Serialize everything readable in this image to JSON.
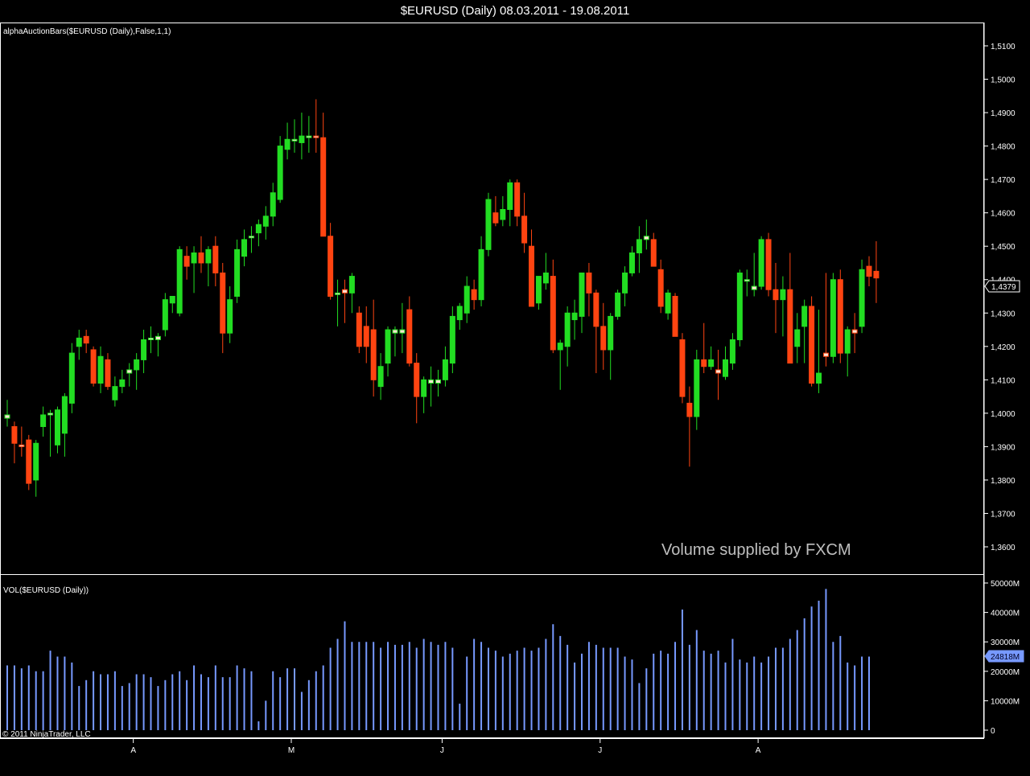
{
  "window": {
    "title": "$EURUSD (Daily)  08.03.2011 - 19.08.2011"
  },
  "price_panel": {
    "label": "alphaAuctionBars($EURUSD (Daily),False,1,1)",
    "current_price": "1,4379"
  },
  "volume_panel": {
    "label": "VOL($EURUSD (Daily))",
    "current_volume": "24818M"
  },
  "watermark": "Volume supplied by FXCM",
  "copyright": "© 2011 NinjaTrader, LLC",
  "colors": {
    "up": "#22dd22",
    "down": "#ff4411",
    "doji_up": "#ffe4d2",
    "volume": "#7799ff",
    "grid": "#ffffff"
  },
  "chart_data": [
    {
      "type": "candlestick",
      "title": "$EURUSD (Daily)  08.03.2011 - 19.08.2011",
      "y_ticks": [
        "1,3600",
        "1,3700",
        "1,3800",
        "1,3900",
        "1,4000",
        "1,4100",
        "1,4200",
        "1,4300",
        "1,4400",
        "1,4500",
        "1,4600",
        "1,4700",
        "1,4800",
        "1,4900",
        "1,5000",
        "1,5100"
      ],
      "ylim": [
        1.352,
        1.5165
      ],
      "x_tick_labels": [
        {
          "label": "A",
          "index": 18
        },
        {
          "label": "M",
          "index": 40
        },
        {
          "label": "J",
          "index": 61
        },
        {
          "label": "J",
          "index": 83
        },
        {
          "label": "A",
          "index": 105
        }
      ],
      "bars": [
        {
          "o": 1.3985,
          "h": 1.404,
          "l": 1.396,
          "c": 1.3995
        },
        {
          "o": 1.396,
          "h": 1.3975,
          "l": 1.385,
          "c": 1.391
        },
        {
          "o": 1.3905,
          "h": 1.396,
          "l": 1.387,
          "c": 1.39
        },
        {
          "o": 1.392,
          "h": 1.3935,
          "l": 1.377,
          "c": 1.379
        },
        {
          "o": 1.38,
          "h": 1.392,
          "l": 1.375,
          "c": 1.391
        },
        {
          "o": 1.396,
          "h": 1.402,
          "l": 1.393,
          "c": 1.3995
        },
        {
          "o": 1.3995,
          "h": 1.401,
          "l": 1.387,
          "c": 1.4
        },
        {
          "o": 1.3905,
          "h": 1.402,
          "l": 1.388,
          "c": 1.401
        },
        {
          "o": 1.394,
          "h": 1.406,
          "l": 1.387,
          "c": 1.405
        },
        {
          "o": 1.403,
          "h": 1.421,
          "l": 1.4,
          "c": 1.418
        },
        {
          "o": 1.42,
          "h": 1.425,
          "l": 1.416,
          "c": 1.4225
        },
        {
          "o": 1.423,
          "h": 1.425,
          "l": 1.418,
          "c": 1.421
        },
        {
          "o": 1.419,
          "h": 1.42,
          "l": 1.408,
          "c": 1.409
        },
        {
          "o": 1.409,
          "h": 1.42,
          "l": 1.406,
          "c": 1.417
        },
        {
          "o": 1.416,
          "h": 1.418,
          "l": 1.407,
          "c": 1.408
        },
        {
          "o": 1.404,
          "h": 1.411,
          "l": 1.402,
          "c": 1.408
        },
        {
          "o": 1.408,
          "h": 1.413,
          "l": 1.406,
          "c": 1.41
        },
        {
          "o": 1.412,
          "h": 1.415,
          "l": 1.408,
          "c": 1.413
        },
        {
          "o": 1.413,
          "h": 1.418,
          "l": 1.407,
          "c": 1.416
        },
        {
          "o": 1.416,
          "h": 1.425,
          "l": 1.412,
          "c": 1.422
        },
        {
          "o": 1.422,
          "h": 1.426,
          "l": 1.418,
          "c": 1.4225
        },
        {
          "o": 1.422,
          "h": 1.424,
          "l": 1.417,
          "c": 1.423
        },
        {
          "o": 1.425,
          "h": 1.436,
          "l": 1.423,
          "c": 1.434
        },
        {
          "o": 1.433,
          "h": 1.435,
          "l": 1.43,
          "c": 1.435
        },
        {
          "o": 1.43,
          "h": 1.45,
          "l": 1.429,
          "c": 1.449
        },
        {
          "o": 1.447,
          "h": 1.45,
          "l": 1.44,
          "c": 1.444
        },
        {
          "o": 1.445,
          "h": 1.45,
          "l": 1.436,
          "c": 1.448
        },
        {
          "o": 1.448,
          "h": 1.453,
          "l": 1.442,
          "c": 1.445
        },
        {
          "o": 1.445,
          "h": 1.45,
          "l": 1.438,
          "c": 1.449
        },
        {
          "o": 1.45,
          "h": 1.453,
          "l": 1.438,
          "c": 1.442
        },
        {
          "o": 1.442,
          "h": 1.445,
          "l": 1.418,
          "c": 1.424
        },
        {
          "o": 1.424,
          "h": 1.438,
          "l": 1.421,
          "c": 1.434
        },
        {
          "o": 1.435,
          "h": 1.452,
          "l": 1.433,
          "c": 1.449
        },
        {
          "o": 1.447,
          "h": 1.455,
          "l": 1.444,
          "c": 1.452
        },
        {
          "o": 1.453,
          "h": 1.456,
          "l": 1.448,
          "c": 1.453
        },
        {
          "o": 1.454,
          "h": 1.458,
          "l": 1.45,
          "c": 1.4565
        },
        {
          "o": 1.456,
          "h": 1.462,
          "l": 1.452,
          "c": 1.459
        },
        {
          "o": 1.459,
          "h": 1.469,
          "l": 1.456,
          "c": 1.466
        },
        {
          "o": 1.464,
          "h": 1.483,
          "l": 1.463,
          "c": 1.48
        },
        {
          "o": 1.479,
          "h": 1.487,
          "l": 1.476,
          "c": 1.482
        },
        {
          "o": 1.4815,
          "h": 1.488,
          "l": 1.478,
          "c": 1.482
        },
        {
          "o": 1.481,
          "h": 1.49,
          "l": 1.476,
          "c": 1.483
        },
        {
          "o": 1.4828,
          "h": 1.489,
          "l": 1.478,
          "c": 1.483
        },
        {
          "o": 1.483,
          "h": 1.494,
          "l": 1.478,
          "c": 1.4828
        },
        {
          "o": 1.4825,
          "h": 1.49,
          "l": 1.457,
          "c": 1.453
        },
        {
          "o": 1.453,
          "h": 1.457,
          "l": 1.434,
          "c": 1.435
        },
        {
          "o": 1.436,
          "h": 1.44,
          "l": 1.426,
          "c": 1.436
        },
        {
          "o": 1.437,
          "h": 1.44,
          "l": 1.427,
          "c": 1.436
        },
        {
          "o": 1.436,
          "h": 1.442,
          "l": 1.43,
          "c": 1.441
        },
        {
          "o": 1.43,
          "h": 1.432,
          "l": 1.418,
          "c": 1.42
        },
        {
          "o": 1.426,
          "h": 1.432,
          "l": 1.415,
          "c": 1.42
        },
        {
          "o": 1.425,
          "h": 1.434,
          "l": 1.405,
          "c": 1.41
        },
        {
          "o": 1.408,
          "h": 1.418,
          "l": 1.404,
          "c": 1.414
        },
        {
          "o": 1.415,
          "h": 1.426,
          "l": 1.411,
          "c": 1.425
        },
        {
          "o": 1.424,
          "h": 1.426,
          "l": 1.417,
          "c": 1.425
        },
        {
          "o": 1.424,
          "h": 1.433,
          "l": 1.418,
          "c": 1.425
        },
        {
          "o": 1.431,
          "h": 1.435,
          "l": 1.414,
          "c": 1.415
        },
        {
          "o": 1.415,
          "h": 1.418,
          "l": 1.397,
          "c": 1.405
        },
        {
          "o": 1.405,
          "h": 1.411,
          "l": 1.4,
          "c": 1.41
        },
        {
          "o": 1.409,
          "h": 1.414,
          "l": 1.402,
          "c": 1.41
        },
        {
          "o": 1.409,
          "h": 1.413,
          "l": 1.405,
          "c": 1.41
        },
        {
          "o": 1.41,
          "h": 1.42,
          "l": 1.408,
          "c": 1.416
        },
        {
          "o": 1.415,
          "h": 1.432,
          "l": 1.412,
          "c": 1.429
        },
        {
          "o": 1.428,
          "h": 1.433,
          "l": 1.425,
          "c": 1.432
        },
        {
          "o": 1.43,
          "h": 1.441,
          "l": 1.427,
          "c": 1.438
        },
        {
          "o": 1.437,
          "h": 1.44,
          "l": 1.431,
          "c": 1.434
        },
        {
          "o": 1.434,
          "h": 1.453,
          "l": 1.432,
          "c": 1.449
        },
        {
          "o": 1.449,
          "h": 1.466,
          "l": 1.447,
          "c": 1.464
        },
        {
          "o": 1.46,
          "h": 1.465,
          "l": 1.456,
          "c": 1.457
        },
        {
          "o": 1.458,
          "h": 1.465,
          "l": 1.456,
          "c": 1.461
        },
        {
          "o": 1.461,
          "h": 1.47,
          "l": 1.456,
          "c": 1.469
        },
        {
          "o": 1.469,
          "h": 1.47,
          "l": 1.456,
          "c": 1.459
        },
        {
          "o": 1.459,
          "h": 1.466,
          "l": 1.448,
          "c": 1.451
        },
        {
          "o": 1.45,
          "h": 1.455,
          "l": 1.432,
          "c": 1.432
        },
        {
          "o": 1.433,
          "h": 1.441,
          "l": 1.431,
          "c": 1.441
        },
        {
          "o": 1.439,
          "h": 1.448,
          "l": 1.437,
          "c": 1.442
        },
        {
          "o": 1.441,
          "h": 1.446,
          "l": 1.418,
          "c": 1.419
        },
        {
          "o": 1.419,
          "h": 1.422,
          "l": 1.407,
          "c": 1.421
        },
        {
          "o": 1.42,
          "h": 1.432,
          "l": 1.414,
          "c": 1.43
        },
        {
          "o": 1.428,
          "h": 1.434,
          "l": 1.422,
          "c": 1.43
        },
        {
          "o": 1.429,
          "h": 1.442,
          "l": 1.424,
          "c": 1.442
        },
        {
          "o": 1.442,
          "h": 1.445,
          "l": 1.429,
          "c": 1.436
        },
        {
          "o": 1.436,
          "h": 1.437,
          "l": 1.412,
          "c": 1.426
        },
        {
          "o": 1.426,
          "h": 1.433,
          "l": 1.413,
          "c": 1.419
        },
        {
          "o": 1.419,
          "h": 1.43,
          "l": 1.41,
          "c": 1.429
        },
        {
          "o": 1.429,
          "h": 1.437,
          "l": 1.428,
          "c": 1.436
        },
        {
          "o": 1.436,
          "h": 1.444,
          "l": 1.432,
          "c": 1.442
        },
        {
          "o": 1.442,
          "h": 1.45,
          "l": 1.441,
          "c": 1.448
        },
        {
          "o": 1.448,
          "h": 1.456,
          "l": 1.442,
          "c": 1.452
        },
        {
          "o": 1.452,
          "h": 1.458,
          "l": 1.449,
          "c": 1.453
        },
        {
          "o": 1.452,
          "h": 1.454,
          "l": 1.444,
          "c": 1.444
        },
        {
          "o": 1.443,
          "h": 1.446,
          "l": 1.43,
          "c": 1.432
        },
        {
          "o": 1.43,
          "h": 1.437,
          "l": 1.428,
          "c": 1.436
        },
        {
          "o": 1.435,
          "h": 1.436,
          "l": 1.423,
          "c": 1.423
        },
        {
          "o": 1.422,
          "h": 1.424,
          "l": 1.403,
          "c": 1.405
        },
        {
          "o": 1.403,
          "h": 1.408,
          "l": 1.384,
          "c": 1.399
        },
        {
          "o": 1.399,
          "h": 1.419,
          "l": 1.395,
          "c": 1.416
        },
        {
          "o": 1.416,
          "h": 1.427,
          "l": 1.412,
          "c": 1.414
        },
        {
          "o": 1.414,
          "h": 1.42,
          "l": 1.413,
          "c": 1.416
        },
        {
          "o": 1.413,
          "h": 1.419,
          "l": 1.404,
          "c": 1.412
        },
        {
          "o": 1.411,
          "h": 1.42,
          "l": 1.41,
          "c": 1.416
        },
        {
          "o": 1.415,
          "h": 1.424,
          "l": 1.413,
          "c": 1.422
        },
        {
          "o": 1.422,
          "h": 1.443,
          "l": 1.42,
          "c": 1.442
        },
        {
          "o": 1.44,
          "h": 1.443,
          "l": 1.435,
          "c": 1.44
        },
        {
          "o": 1.437,
          "h": 1.448,
          "l": 1.435,
          "c": 1.438
        },
        {
          "o": 1.438,
          "h": 1.453,
          "l": 1.437,
          "c": 1.452
        },
        {
          "o": 1.452,
          "h": 1.454,
          "l": 1.435,
          "c": 1.437
        },
        {
          "o": 1.437,
          "h": 1.445,
          "l": 1.424,
          "c": 1.434
        },
        {
          "o": 1.434,
          "h": 1.441,
          "l": 1.423,
          "c": 1.437
        },
        {
          "o": 1.437,
          "h": 1.448,
          "l": 1.415,
          "c": 1.415
        },
        {
          "o": 1.42,
          "h": 1.43,
          "l": 1.415,
          "c": 1.425
        },
        {
          "o": 1.426,
          "h": 1.434,
          "l": 1.415,
          "c": 1.432
        },
        {
          "o": 1.432,
          "h": 1.435,
          "l": 1.408,
          "c": 1.409
        },
        {
          "o": 1.409,
          "h": 1.431,
          "l": 1.406,
          "c": 1.412
        },
        {
          "o": 1.418,
          "h": 1.442,
          "l": 1.414,
          "c": 1.417
        },
        {
          "o": 1.417,
          "h": 1.442,
          "l": 1.415,
          "c": 1.44
        },
        {
          "o": 1.44,
          "h": 1.443,
          "l": 1.415,
          "c": 1.418
        },
        {
          "o": 1.418,
          "h": 1.426,
          "l": 1.411,
          "c": 1.425
        },
        {
          "o": 1.425,
          "h": 1.43,
          "l": 1.418,
          "c": 1.424
        },
        {
          "o": 1.426,
          "h": 1.446,
          "l": 1.424,
          "c": 1.443
        },
        {
          "o": 1.444,
          "h": 1.447,
          "l": 1.438,
          "c": 1.441
        },
        {
          "o": 1.4425,
          "h": 1.4515,
          "l": 1.433,
          "c": 1.4405
        }
      ]
    },
    {
      "type": "bar",
      "title": "VOL($EURUSD (Daily))",
      "y_ticks": [
        "0",
        "10000M",
        "20000M",
        "30000M",
        "40000M",
        "50000M"
      ],
      "ylim": [
        0,
        50000
      ],
      "unit": "M",
      "values": [
        22000,
        22000,
        21000,
        22000,
        20000,
        20000,
        27000,
        25000,
        25000,
        23000,
        15000,
        17000,
        20000,
        19000,
        19000,
        20000,
        15000,
        16000,
        19000,
        19000,
        18000,
        15000,
        17000,
        19000,
        20000,
        17000,
        22000,
        19000,
        18000,
        22000,
        18000,
        18000,
        22000,
        21000,
        20000,
        3000,
        10000,
        20000,
        18000,
        21000,
        21000,
        13000,
        17000,
        20000,
        22000,
        28000,
        31000,
        37000,
        30000,
        30000,
        30000,
        30000,
        28000,
        30000,
        29000,
        29000,
        30000,
        28000,
        31000,
        30000,
        29000,
        30000,
        28000,
        9000,
        25000,
        31000,
        30000,
        28000,
        27000,
        25000,
        26000,
        27000,
        28000,
        27000,
        28000,
        31000,
        36000,
        32000,
        29000,
        23000,
        26000,
        30000,
        29000,
        28000,
        28000,
        28000,
        25000,
        24000,
        16000,
        21000,
        26000,
        27000,
        26000,
        30000,
        41000,
        29000,
        34000,
        27000,
        26000,
        27000,
        23000,
        31000,
        24000,
        23000,
        25000,
        23000,
        25000,
        28000,
        28000,
        31000,
        34000,
        38000,
        42000,
        44000,
        48000,
        30000,
        32000,
        23000,
        22000,
        25000,
        25000
      ]
    }
  ]
}
